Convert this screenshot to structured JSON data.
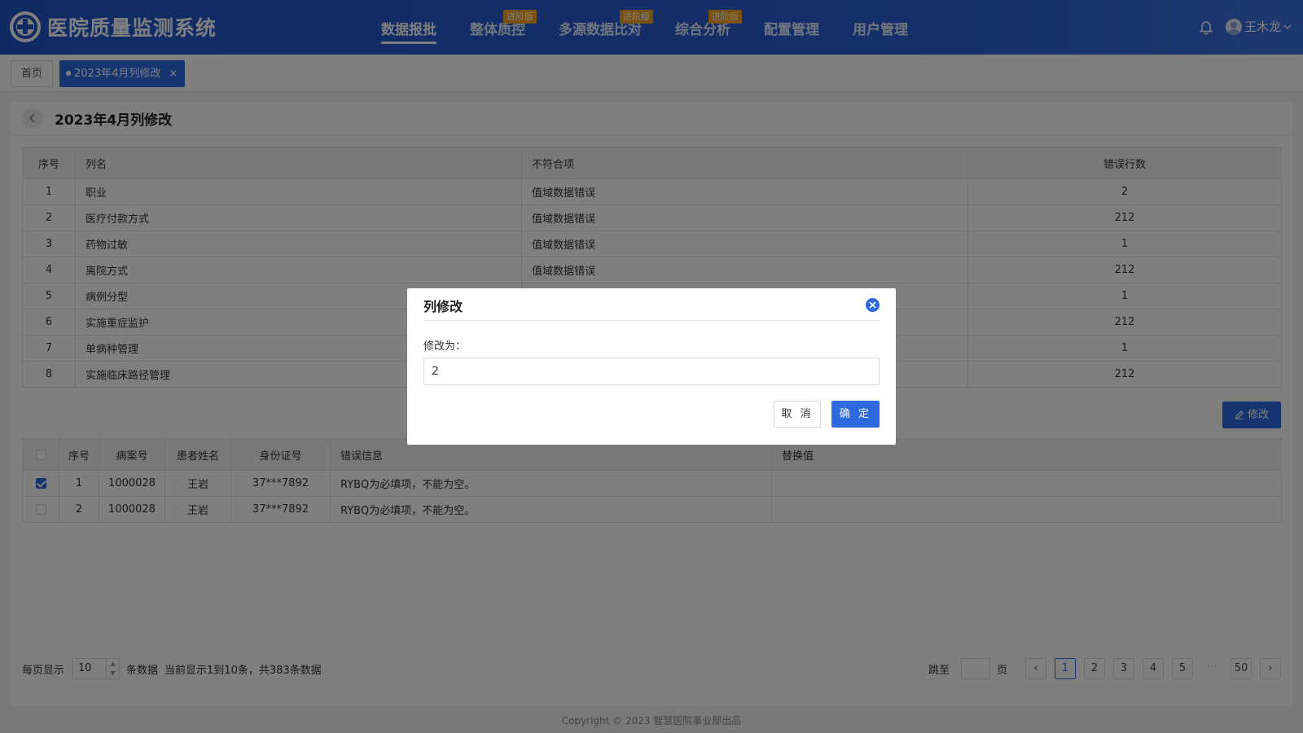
{
  "app": {
    "title": "医院质量监测系统"
  },
  "nav": {
    "items": [
      {
        "label": "数据报批",
        "badge": ""
      },
      {
        "label": "整体质控",
        "badge": "进阶版"
      },
      {
        "label": "多源数据比对",
        "badge": "进阶版"
      },
      {
        "label": "综合分析",
        "badge": "进阶版"
      },
      {
        "label": "配置管理",
        "badge": ""
      },
      {
        "label": "用户管理",
        "badge": ""
      }
    ]
  },
  "user": {
    "name": "王木龙"
  },
  "tabs": {
    "home": "首页",
    "current": "2023年4月列修改",
    "close": "×"
  },
  "page": {
    "title": "2023年4月列修改"
  },
  "table1": {
    "headers": [
      "序号",
      "列名",
      "不符合项",
      "错误行数"
    ],
    "rows": [
      [
        "1",
        "职业",
        "值域数据错误",
        "2"
      ],
      [
        "2",
        "医疗付款方式",
        "值域数据错误",
        "212"
      ],
      [
        "3",
        "药物过敏",
        "值域数据错误",
        "1"
      ],
      [
        "4",
        "离院方式",
        "值域数据错误",
        "212"
      ],
      [
        "5",
        "病例分型",
        "",
        "1"
      ],
      [
        "6",
        "实施重症监护",
        "",
        "212"
      ],
      [
        "7",
        "单病种管理",
        "",
        "1"
      ],
      [
        "8",
        "实施临床路径管理",
        "",
        "212"
      ]
    ]
  },
  "edit_button": {
    "label": "修改"
  },
  "table2": {
    "headers": [
      "序号",
      "病案号",
      "患者姓名",
      "身份证号",
      "错误信息",
      "替换值"
    ],
    "rows": [
      {
        "checked": true,
        "cells": [
          "1",
          "1000028",
          "王岩",
          "37***7892",
          "RYBQ为必填项，不能为空。",
          ""
        ]
      },
      {
        "checked": false,
        "cells": [
          "2",
          "1000028",
          "王岩",
          "37***7892",
          "RYBQ为必填项，不能为空。",
          ""
        ]
      }
    ]
  },
  "pager": {
    "per_page_label": "每页显示",
    "per_page_value": "10",
    "unit": "条数据",
    "info": "当前显示1到10条，共383条数据",
    "jump_label": "跳至",
    "page_label": "页",
    "prev": "‹",
    "next": "›",
    "pages": [
      "1",
      "2",
      "3",
      "4",
      "5",
      "···",
      "50"
    ],
    "current": "1"
  },
  "footer": {
    "copyright": "Copyright © 2023 智慧医院事业部出品"
  },
  "modal": {
    "title": "列修改",
    "label": "修改为：",
    "value": "2",
    "cancel": "取 消",
    "ok": "确 定"
  },
  "colors": {
    "primary": "#2d6ae0",
    "header": "#2156c9",
    "badge": "#f0a020"
  }
}
